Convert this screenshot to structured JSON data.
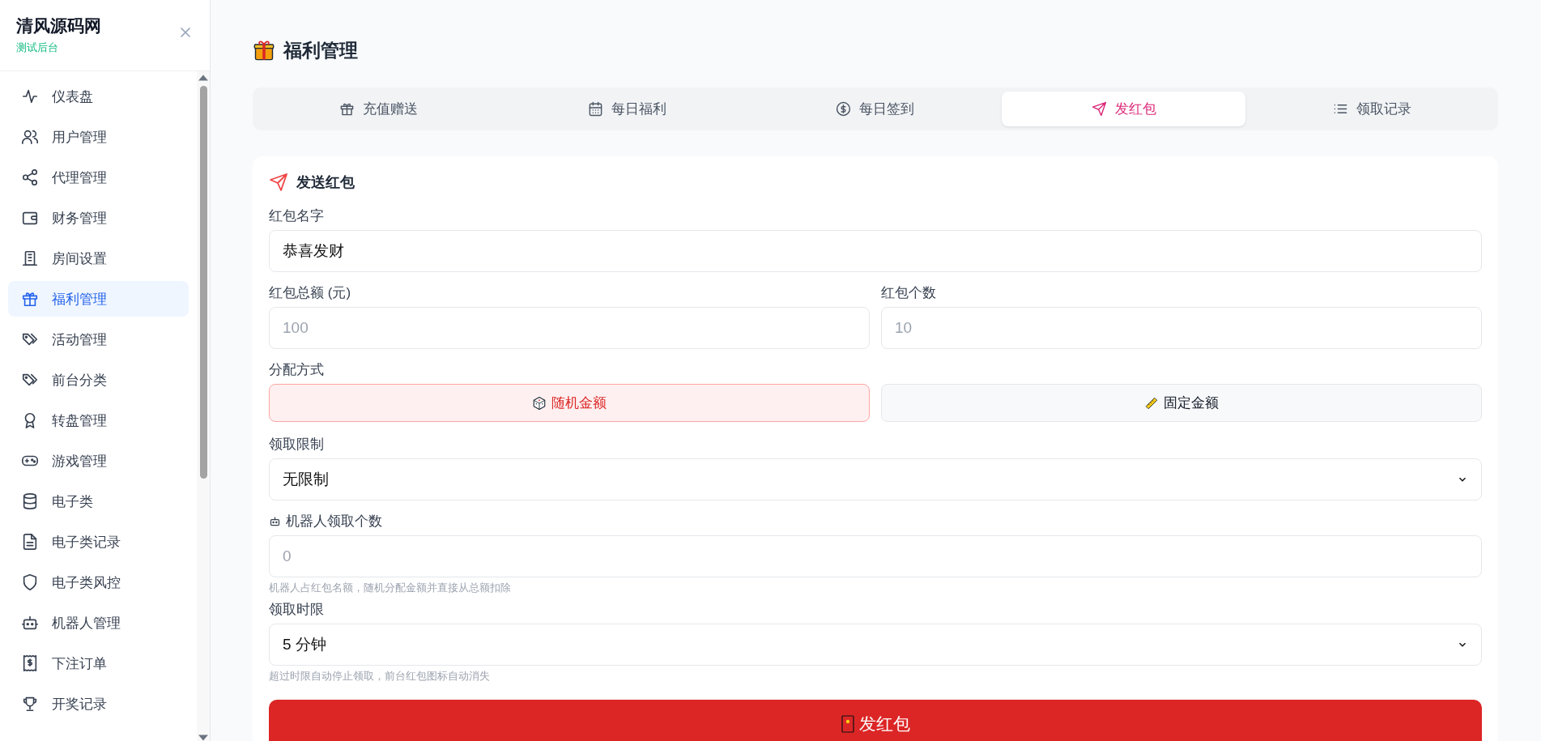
{
  "sidebar": {
    "title": "清风源码网",
    "subtitle": "测试后台",
    "items": [
      {
        "label": "仪表盘",
        "selected": false
      },
      {
        "label": "用户管理",
        "selected": false
      },
      {
        "label": "代理管理",
        "selected": false
      },
      {
        "label": "财务管理",
        "selected": false
      },
      {
        "label": "房间设置",
        "selected": false
      },
      {
        "label": "福利管理",
        "selected": true
      },
      {
        "label": "活动管理",
        "selected": false
      },
      {
        "label": "前台分类",
        "selected": false
      },
      {
        "label": "转盘管理",
        "selected": false
      },
      {
        "label": "游戏管理",
        "selected": false
      },
      {
        "label": "电子类",
        "selected": false
      },
      {
        "label": "电子类记录",
        "selected": false
      },
      {
        "label": "电子类风控",
        "selected": false
      },
      {
        "label": "机器人管理",
        "selected": false
      },
      {
        "label": "下注订单",
        "selected": false
      },
      {
        "label": "开奖记录",
        "selected": false
      }
    ]
  },
  "page": {
    "title": "福利管理"
  },
  "tabs": [
    {
      "label": "充值赠送",
      "selected": false
    },
    {
      "label": "每日福利",
      "selected": false
    },
    {
      "label": "每日签到",
      "selected": false
    },
    {
      "label": "发红包",
      "selected": true
    },
    {
      "label": "领取记录",
      "selected": false
    }
  ],
  "form": {
    "heading": "发送红包",
    "name": {
      "label": "红包名字",
      "value": "恭喜发财"
    },
    "amount": {
      "label": "红包总额 (元)",
      "placeholder": "100"
    },
    "count": {
      "label": "红包个数",
      "placeholder": "10"
    },
    "distribution": {
      "label": "分配方式",
      "options": [
        {
          "label": "随机金额",
          "selected": true
        },
        {
          "label": "固定金额",
          "selected": false
        }
      ]
    },
    "limit": {
      "label": "领取限制",
      "value": "无限制"
    },
    "robot": {
      "label": "机器人领取个数",
      "placeholder": "0",
      "hint": "机器人占红包名额，随机分配金额并直接从总额扣除"
    },
    "duration": {
      "label": "领取时限",
      "value": "5 分钟",
      "hint": "超过时限自动停止领取，前台红包图标自动消失"
    },
    "submit": "发红包"
  }
}
